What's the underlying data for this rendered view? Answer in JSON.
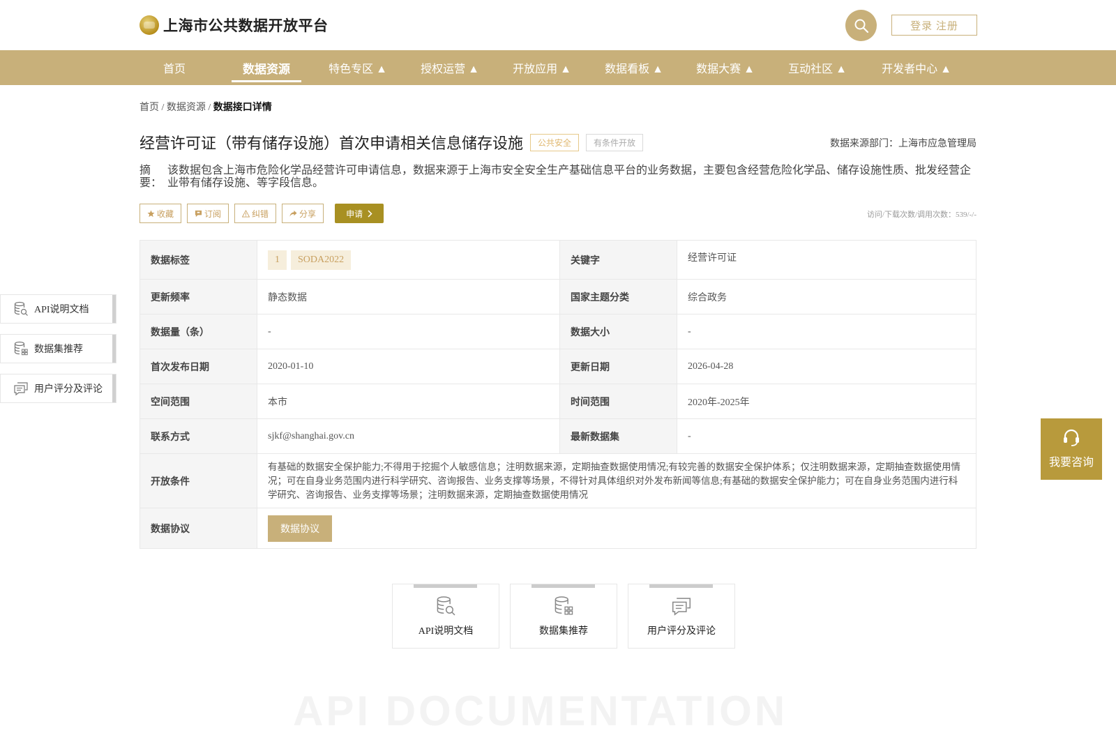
{
  "header": {
    "logo_text": "上海市公共数据开放平台",
    "login_label": "登录 注册"
  },
  "nav": {
    "items": [
      {
        "label": "首页"
      },
      {
        "label": "数据资源"
      },
      {
        "label": "特色专区 ▲"
      },
      {
        "label": "授权运营 ▲"
      },
      {
        "label": "开放应用 ▲"
      },
      {
        "label": "数据看板 ▲"
      },
      {
        "label": "数据大赛 ▲"
      },
      {
        "label": "互动社区 ▲"
      },
      {
        "label": "开发者中心 ▲"
      }
    ]
  },
  "breadcrumb": {
    "home": "首页",
    "sep": " / ",
    "section": "数据资源",
    "current": "数据接口详情"
  },
  "dataset": {
    "title": "经营许可证（带有储存设施）首次申请相关信息储存设施",
    "tag_category": "公共安全",
    "tag_open": "有条件开放",
    "source": "数据来源部门：上海市应急管理局",
    "abstract_label": "摘　要：",
    "abstract": "该数据包含上海市危险化学品经营许可申请信息，数据来源于上海市安全安全生产基础信息平台的业务数据，主要包含经营危险化学品、储存设施性质、批发经营企业带有储存设施、等字段信息。",
    "stats": "访问/下载次数/调用次数：539/-/-"
  },
  "actions": {
    "favorite": "收藏",
    "subscribe": "订阅",
    "report": "纠错",
    "share": "分享",
    "apply": "申请"
  },
  "table": {
    "tags_label": "数据标签",
    "tags": [
      "1",
      "SODA2022"
    ],
    "keyword_label": "关键字",
    "keyword": "经营许可证",
    "freq_label": "更新频率",
    "freq": "静态数据",
    "theme_label": "国家主题分类",
    "theme": "综合政务",
    "count_label": "数据量（条）",
    "count": "-",
    "size_label": "数据大小",
    "size": "-",
    "first_label": "首次发布日期",
    "first": "2020-01-10",
    "updated_label": "更新日期",
    "updated": "2026-04-28",
    "space_label": "空间范围",
    "space": "本市",
    "time_label": "时间范围",
    "time": "2020年-2025年",
    "contact_label": "联系方式",
    "contact": "sjkf@shanghai.gov.cn",
    "latest_label": "最新数据集",
    "latest": "-",
    "cond_label": "开放条件",
    "cond": "有基础的数据安全保护能力;不得用于挖掘个人敏感信息；注明数据来源，定期抽查数据使用情况;有较完善的数据安全保护体系；仅注明数据来源，定期抽查数据使用情况；可在自身业务范围内进行科学研究、咨询报告、业务支撑等场景，不得针对具体组织对外发布新闻等信息;有基础的数据安全保护能力；可在自身业务范围内进行科学研究、咨询报告、业务支撑等场景；注明数据来源，定期抽查数据使用情况",
    "proto_label": "数据协议",
    "proto_button": "数据协议"
  },
  "side_nav": {
    "api": "API说明文档",
    "recommend": "数据集推荐",
    "comments": "用户评分及评论"
  },
  "consult": {
    "label": "我要咨询"
  },
  "cards": {
    "api": "API说明文档",
    "recommend": "数据集推荐",
    "comments": "用户评分及评论"
  },
  "watermark": "API DOCUMENTATION",
  "colors": {
    "brand": "#c8b07a",
    "apply": "#a89022",
    "consult": "#b89a3c"
  }
}
